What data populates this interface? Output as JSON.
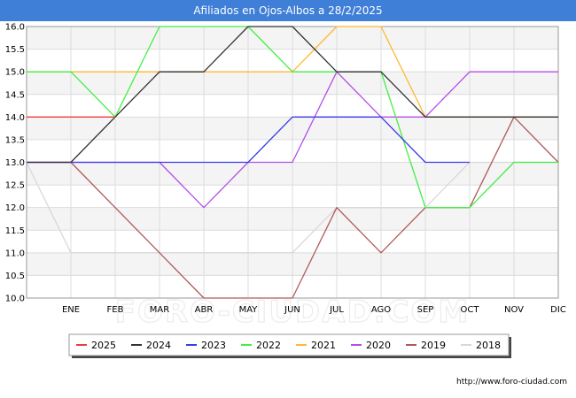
{
  "chart_data": {
    "type": "line",
    "title": "Afiliados en Ojos-Albos a 28/2/2025",
    "categories": [
      "",
      "ENE",
      "FEB",
      "MAR",
      "ABR",
      "MAY",
      "JUN",
      "JUL",
      "AGO",
      "SEP",
      "OCT",
      "NOV",
      "DIC"
    ],
    "ylim": [
      10.0,
      16.0
    ],
    "yticks": [
      "10.0",
      "10.5",
      "11.0",
      "11.5",
      "12.0",
      "12.5",
      "13.0",
      "13.5",
      "14.0",
      "14.5",
      "15.0",
      "15.5",
      "16.0"
    ],
    "grid": true,
    "legend_position": "bottom",
    "series": [
      {
        "name": "2018",
        "color": "#d8d8d8",
        "values": [
          13,
          11,
          11,
          11,
          11,
          11,
          11,
          12,
          12,
          12,
          13,
          13,
          13
        ]
      },
      {
        "name": "2019",
        "color": "#b05a5a",
        "values": [
          13,
          13,
          12,
          11,
          10,
          10,
          10,
          12,
          11,
          12,
          12,
          14,
          13
        ]
      },
      {
        "name": "2020",
        "color": "#b44ee8",
        "values": [
          13,
          13,
          13,
          13,
          12,
          13,
          13,
          15,
          14,
          14,
          15,
          15,
          15
        ]
      },
      {
        "name": "2021",
        "color": "#ffb830",
        "values": [
          15,
          15,
          15,
          15,
          15,
          15,
          15,
          16,
          16,
          14,
          14,
          14,
          14
        ]
      },
      {
        "name": "2022",
        "color": "#44ee44",
        "values": [
          15,
          15,
          14,
          16,
          16,
          16,
          15,
          15,
          15,
          12,
          12,
          13,
          13
        ]
      },
      {
        "name": "2023",
        "color": "#3b3bea",
        "values": [
          13,
          13,
          13,
          13,
          13,
          13,
          14,
          14,
          14,
          13,
          13,
          null,
          null
        ]
      },
      {
        "name": "2024",
        "color": "#333333",
        "values": [
          13,
          13,
          14,
          15,
          15,
          16,
          16,
          15,
          15,
          14,
          14,
          14,
          14
        ]
      },
      {
        "name": "2025",
        "color": "#ee3b3b",
        "values": [
          14,
          14,
          14,
          null,
          null,
          null,
          null,
          null,
          null,
          null,
          null,
          null,
          null
        ]
      }
    ],
    "legend_order": [
      "2025",
      "2024",
      "2023",
      "2022",
      "2021",
      "2020",
      "2019",
      "2018"
    ]
  },
  "watermark": "FORO-CIUDAD.COM",
  "footer_url": "http://www.foro-ciudad.com"
}
